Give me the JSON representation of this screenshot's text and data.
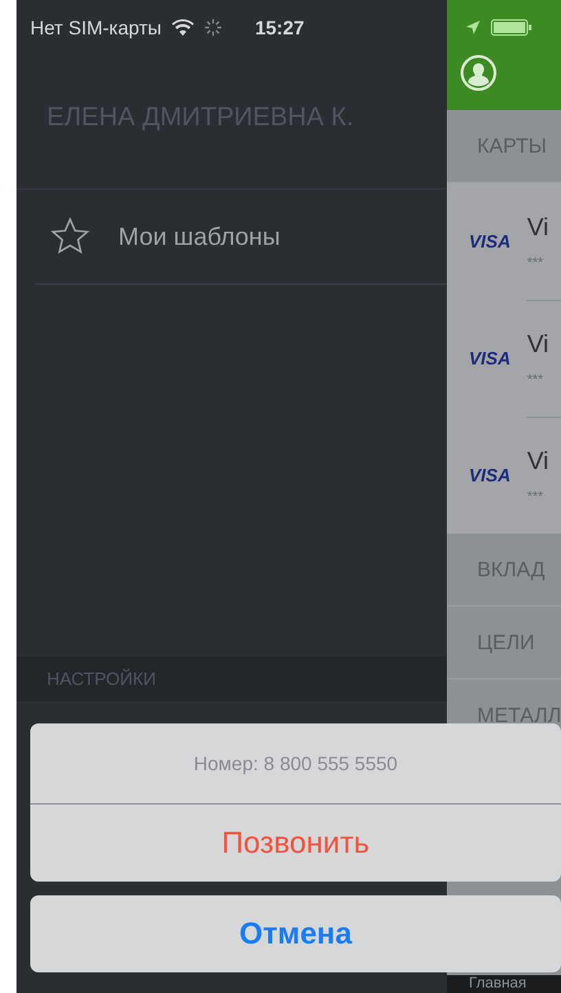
{
  "status_bar": {
    "carrier": "Нет SIM-карты",
    "time": "15:27"
  },
  "menu": {
    "user_name": "ЕЛЕНА ДМИТРИЕВНА К.",
    "items": [
      {
        "label": "Мои шаблоны",
        "kind": "star"
      }
    ],
    "section": "НАСТРОЙКИ"
  },
  "main": {
    "sections": [
      {
        "title": "КАРТЫ",
        "cards": [
          {
            "logo": "VISA",
            "title": "Vi",
            "number": "***"
          },
          {
            "logo": "VISA",
            "title": "Vi",
            "number": "***"
          },
          {
            "logo": "VISA",
            "title": "Vi",
            "number": "***"
          }
        ]
      },
      {
        "title": "ВКЛАД"
      },
      {
        "title": "ЦЕЛИ"
      },
      {
        "title": "МЕТАЛЛ"
      }
    ],
    "tab_bar": {
      "label": "Главная"
    }
  },
  "action_sheet": {
    "message": "Номер: 8 800 555 5550",
    "actions": [
      {
        "label": "Позвонить",
        "kind": "destructive"
      }
    ],
    "cancel": "Отмена"
  }
}
